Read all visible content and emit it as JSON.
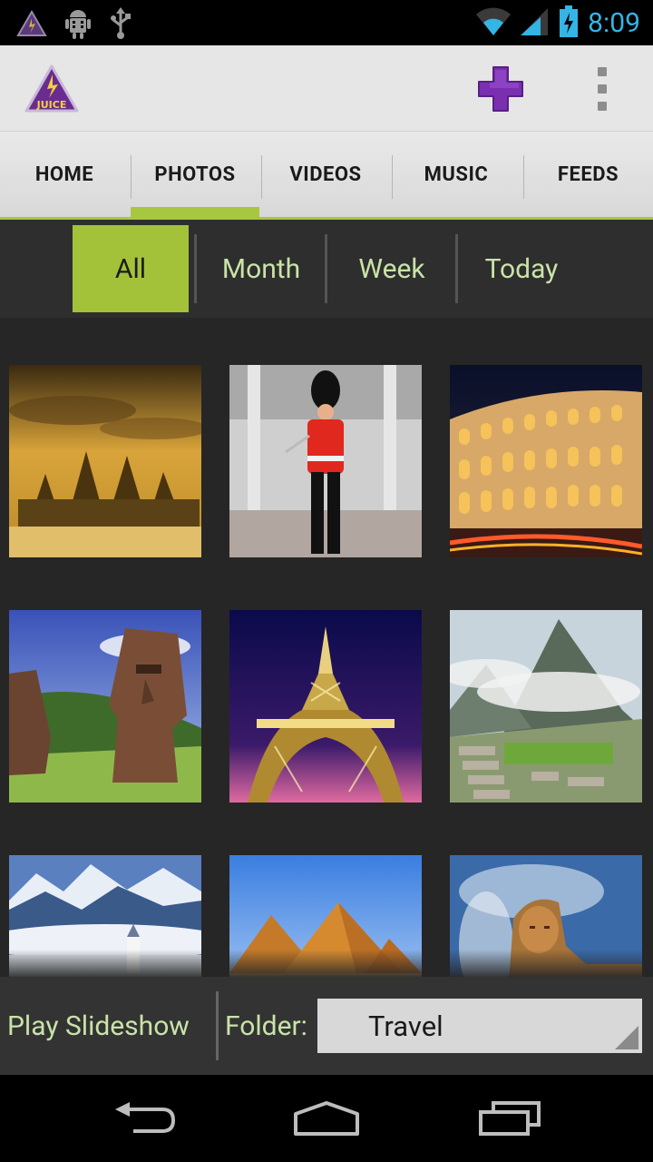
{
  "status_bar": {
    "time": "8:09",
    "left_icons": [
      "juice-notification-icon",
      "android-debug-icon",
      "usb-icon"
    ],
    "right_icons": [
      "wifi-icon",
      "signal-icon",
      "battery-charging-icon"
    ]
  },
  "action_bar": {
    "logo_text": "JUICE",
    "add_icon": "add-plus-icon",
    "overflow_icon": "overflow-menu-icon",
    "colors": {
      "brand_purple": "#6a2c91",
      "accent_green": "#a8c740"
    }
  },
  "tabs": [
    {
      "label": "HOME"
    },
    {
      "label": "PHOTOS",
      "active": true
    },
    {
      "label": "VIDEOS"
    },
    {
      "label": "MUSIC"
    },
    {
      "label": "FEEDS"
    }
  ],
  "filters": [
    {
      "label": "All",
      "active": true
    },
    {
      "label": "Month"
    },
    {
      "label": "Week"
    },
    {
      "label": "Today"
    }
  ],
  "gallery": {
    "photos": [
      {
        "subject": "angkor-wat"
      },
      {
        "subject": "royal-guard"
      },
      {
        "subject": "colosseum"
      },
      {
        "subject": "moai-statues"
      },
      {
        "subject": "eiffel-tower"
      },
      {
        "subject": "machu-picchu"
      },
      {
        "subject": "neuschwanstein-castle"
      },
      {
        "subject": "giza-pyramids"
      },
      {
        "subject": "sphinx"
      }
    ]
  },
  "bottom_bar": {
    "play_label": "Play Slideshow",
    "folder_label": "Folder:",
    "folder_value": "Travel"
  },
  "nav_bar": {
    "icons": [
      "back-icon",
      "home-icon",
      "recent-apps-icon"
    ]
  }
}
